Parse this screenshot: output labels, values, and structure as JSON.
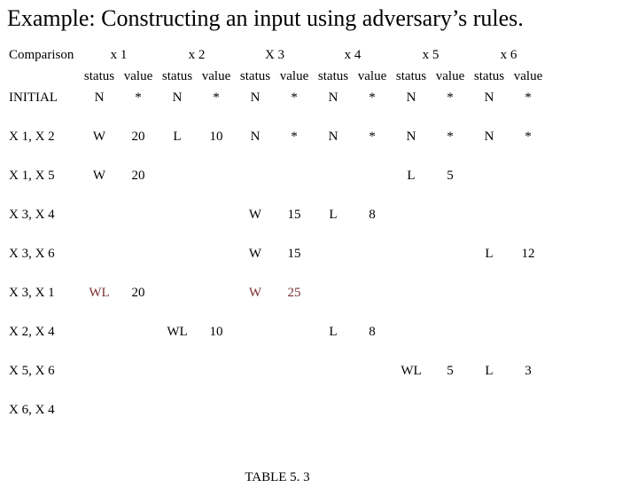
{
  "title": "Example: Constructing an input using adversary’s rules.",
  "header": {
    "comparison": "Comparison",
    "cols": [
      "x 1",
      "x 2",
      "X 3",
      "x 4",
      "x 5",
      "x 6"
    ]
  },
  "subheader": {
    "status": "status",
    "value": "value"
  },
  "rows": {
    "initial": {
      "label": "INITIAL",
      "c": [
        [
          "N",
          "*"
        ],
        [
          "N",
          "*"
        ],
        [
          "N",
          "*"
        ],
        [
          "N",
          "*"
        ],
        [
          "N",
          "*"
        ],
        [
          "N",
          "*"
        ]
      ]
    },
    "x1x2": {
      "label": "X 1, X 2",
      "c": [
        [
          "W",
          "20"
        ],
        [
          "L",
          "10"
        ],
        [
          "N",
          "*"
        ],
        [
          "N",
          "*"
        ],
        [
          "N",
          "*"
        ],
        [
          "N",
          "*"
        ]
      ]
    },
    "x1x5": {
      "label": "X 1, X 5",
      "c": [
        [
          "W",
          "20"
        ],
        [
          "",
          ""
        ],
        [
          "",
          ""
        ],
        [
          "",
          ""
        ],
        [
          "L",
          "5"
        ],
        [
          "",
          ""
        ]
      ]
    },
    "x3x4": {
      "label": "X 3, X 4",
      "c": [
        [
          "",
          ""
        ],
        [
          "",
          ""
        ],
        [
          "W",
          "15"
        ],
        [
          "L",
          "8"
        ],
        [
          "",
          ""
        ],
        [
          "",
          ""
        ]
      ]
    },
    "x3x6": {
      "label": "X 3, X 6",
      "c": [
        [
          "",
          ""
        ],
        [
          "",
          ""
        ],
        [
          "W",
          "15"
        ],
        [
          "",
          ""
        ],
        [
          "",
          ""
        ],
        [
          "L",
          "12"
        ]
      ]
    },
    "x3x1": {
      "label": "X 3, X 1",
      "c": [
        [
          "WL",
          "20"
        ],
        [
          "",
          ""
        ],
        [
          "W",
          "25"
        ],
        [
          "",
          ""
        ],
        [
          "",
          ""
        ],
        [
          "",
          ""
        ]
      ]
    },
    "x2x4": {
      "label": "X 2, X 4",
      "c": [
        [
          "",
          ""
        ],
        [
          "WL",
          "10"
        ],
        [
          "",
          ""
        ],
        [
          "L",
          "8"
        ],
        [
          "",
          ""
        ],
        [
          "",
          ""
        ]
      ]
    },
    "x5x6": {
      "label": "X 5, X 6",
      "c": [
        [
          "",
          ""
        ],
        [
          "",
          ""
        ],
        [
          "",
          ""
        ],
        [
          "",
          ""
        ],
        [
          "WL",
          "5"
        ],
        [
          "L",
          "3"
        ]
      ]
    },
    "x6x4": {
      "label": "X 6, X 4",
      "c": [
        [
          "",
          ""
        ],
        [
          "",
          ""
        ],
        [
          "",
          ""
        ],
        [
          "",
          ""
        ],
        [
          "",
          ""
        ],
        [
          "",
          ""
        ]
      ]
    }
  },
  "caption": "TABLE 5. 3"
}
